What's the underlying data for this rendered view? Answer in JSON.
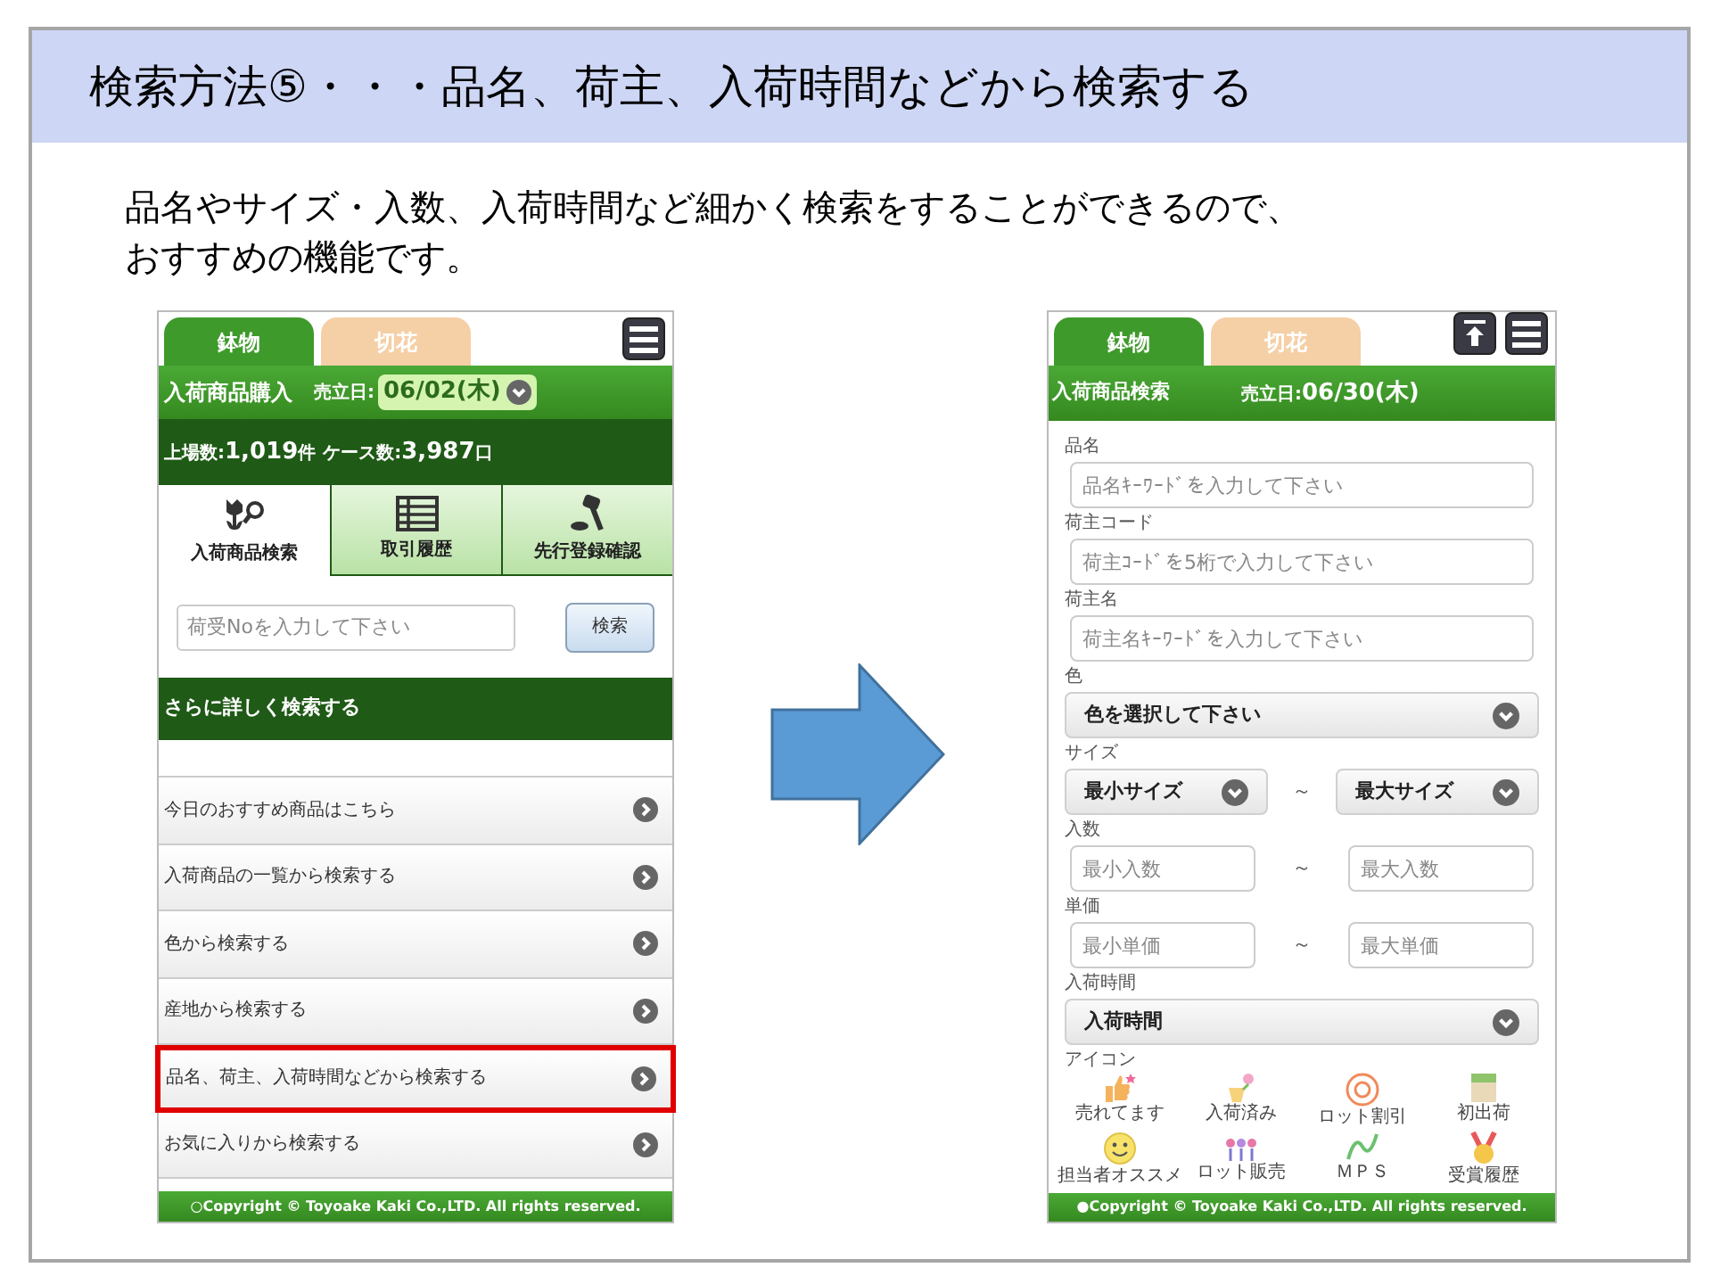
{
  "title": "検索方法⑤・・・品名、荷主、入荷時間などから検索する",
  "description": [
    "品名やサイズ・入数、入荷時間など細かく検索をすることができるので、",
    "おすすめの機能です。"
  ],
  "left_screen": {
    "tabs": [
      {
        "label": "鉢物",
        "selected": true
      },
      {
        "label": "切花",
        "selected": false
      }
    ],
    "header": {
      "title": "入荷商品購入",
      "date_label": "売立日:",
      "date": "06/02(木)"
    },
    "stats": [
      {
        "label": "上場数:",
        "value": "1,019",
        "unit": "件"
      },
      {
        "label": "ケース数:",
        "value": "3,987",
        "unit": "口"
      }
    ],
    "nav": [
      {
        "label": "入荷商品検索",
        "selected": true
      },
      {
        "label": "取引履歴",
        "selected": false
      },
      {
        "label": "先行登録確認",
        "selected": false
      }
    ],
    "search": {
      "placeholder": "荷受Noを入力して下さい",
      "button": "検索"
    },
    "section": "さらに詳しく検索する",
    "menu": [
      {
        "label": "今日のおすすめ商品はこちら",
        "highlighted": false
      },
      {
        "label": "入荷商品の一覧から検索する",
        "highlighted": false
      },
      {
        "label": "色から検索する",
        "highlighted": false
      },
      {
        "label": "産地から検索する",
        "highlighted": false
      },
      {
        "label": "品名、荷主、入荷時間などから検索する",
        "highlighted": true
      },
      {
        "label": "お気に入りから検索する",
        "highlighted": false
      }
    ],
    "footer": "○Copyright © Toyoake Kaki Co.,LTD. All rights reserved."
  },
  "right_screen": {
    "tabs": [
      {
        "label": "鉢物",
        "selected": true
      },
      {
        "label": "切花",
        "selected": false
      }
    ],
    "header": {
      "title": "入荷商品検索",
      "date_label": "売立日:",
      "date": "06/30(木)"
    },
    "fields": [
      {
        "kind": "text",
        "label": "品名",
        "placeholder": "品名ｷｰﾜｰﾄﾞを入力して下さい"
      },
      {
        "kind": "text",
        "label": "荷主コード",
        "placeholder": "荷主ｺｰﾄﾞを5桁で入力して下さい"
      },
      {
        "kind": "text",
        "label": "荷主名",
        "placeholder": "荷主名ｷｰﾜｰﾄﾞを入力して下さい"
      },
      {
        "kind": "select",
        "label": "色",
        "value": "色を選択して下さい"
      },
      {
        "kind": "range_select",
        "label": "サイズ",
        "min": "最小サイズ",
        "max": "最大サイズ",
        "separator": "～"
      },
      {
        "kind": "range_text",
        "label": "入数",
        "min_placeholder": "最小入数",
        "max_placeholder": "最大入数",
        "separator": "～"
      },
      {
        "kind": "range_text",
        "label": "単価",
        "min_placeholder": "最小単価",
        "max_placeholder": "最大単価",
        "separator": "～"
      },
      {
        "kind": "select",
        "label": "入荷時間",
        "value": "入荷時間"
      }
    ],
    "icons": {
      "label": "アイコン",
      "items": [
        {
          "label": "売れてます"
        },
        {
          "label": "入荷済み"
        },
        {
          "label": "ロット割引"
        },
        {
          "label": "初出荷"
        },
        {
          "label": "担当者オススメ"
        },
        {
          "label": "ロット販売"
        },
        {
          "label": "ＭＰＳ"
        },
        {
          "label": "受賞履歴"
        }
      ]
    },
    "footer": "●Copyright © Toyoake Kaki Co.,LTD. All rights reserved."
  }
}
